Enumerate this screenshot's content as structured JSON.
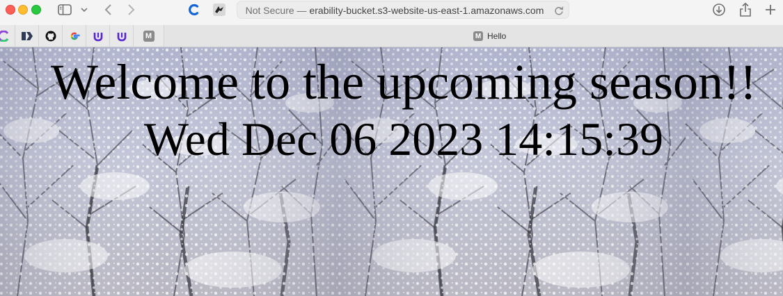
{
  "browser": {
    "address_bar": {
      "security_label": "Not Secure —",
      "url_text": "erability-bucket.s3-website-us-east-1.amazonaws.com"
    },
    "favorites": [
      {
        "icon": "colorful-app-icon"
      },
      {
        "icon": "arrow-app-icon"
      },
      {
        "icon": "github-icon"
      },
      {
        "icon": "google-icon"
      },
      {
        "icon": "udemy-icon"
      },
      {
        "icon": "udemy-icon"
      },
      {
        "icon": "m-icon",
        "letter": "M"
      }
    ],
    "active_tab": {
      "badge_letter": "M",
      "title": "Hello"
    }
  },
  "page": {
    "headline": "Welcome to the upcoming season!!",
    "datetime": "Wed Dec 06 2023 14:15:39",
    "background": "snowy-forest-image"
  }
}
